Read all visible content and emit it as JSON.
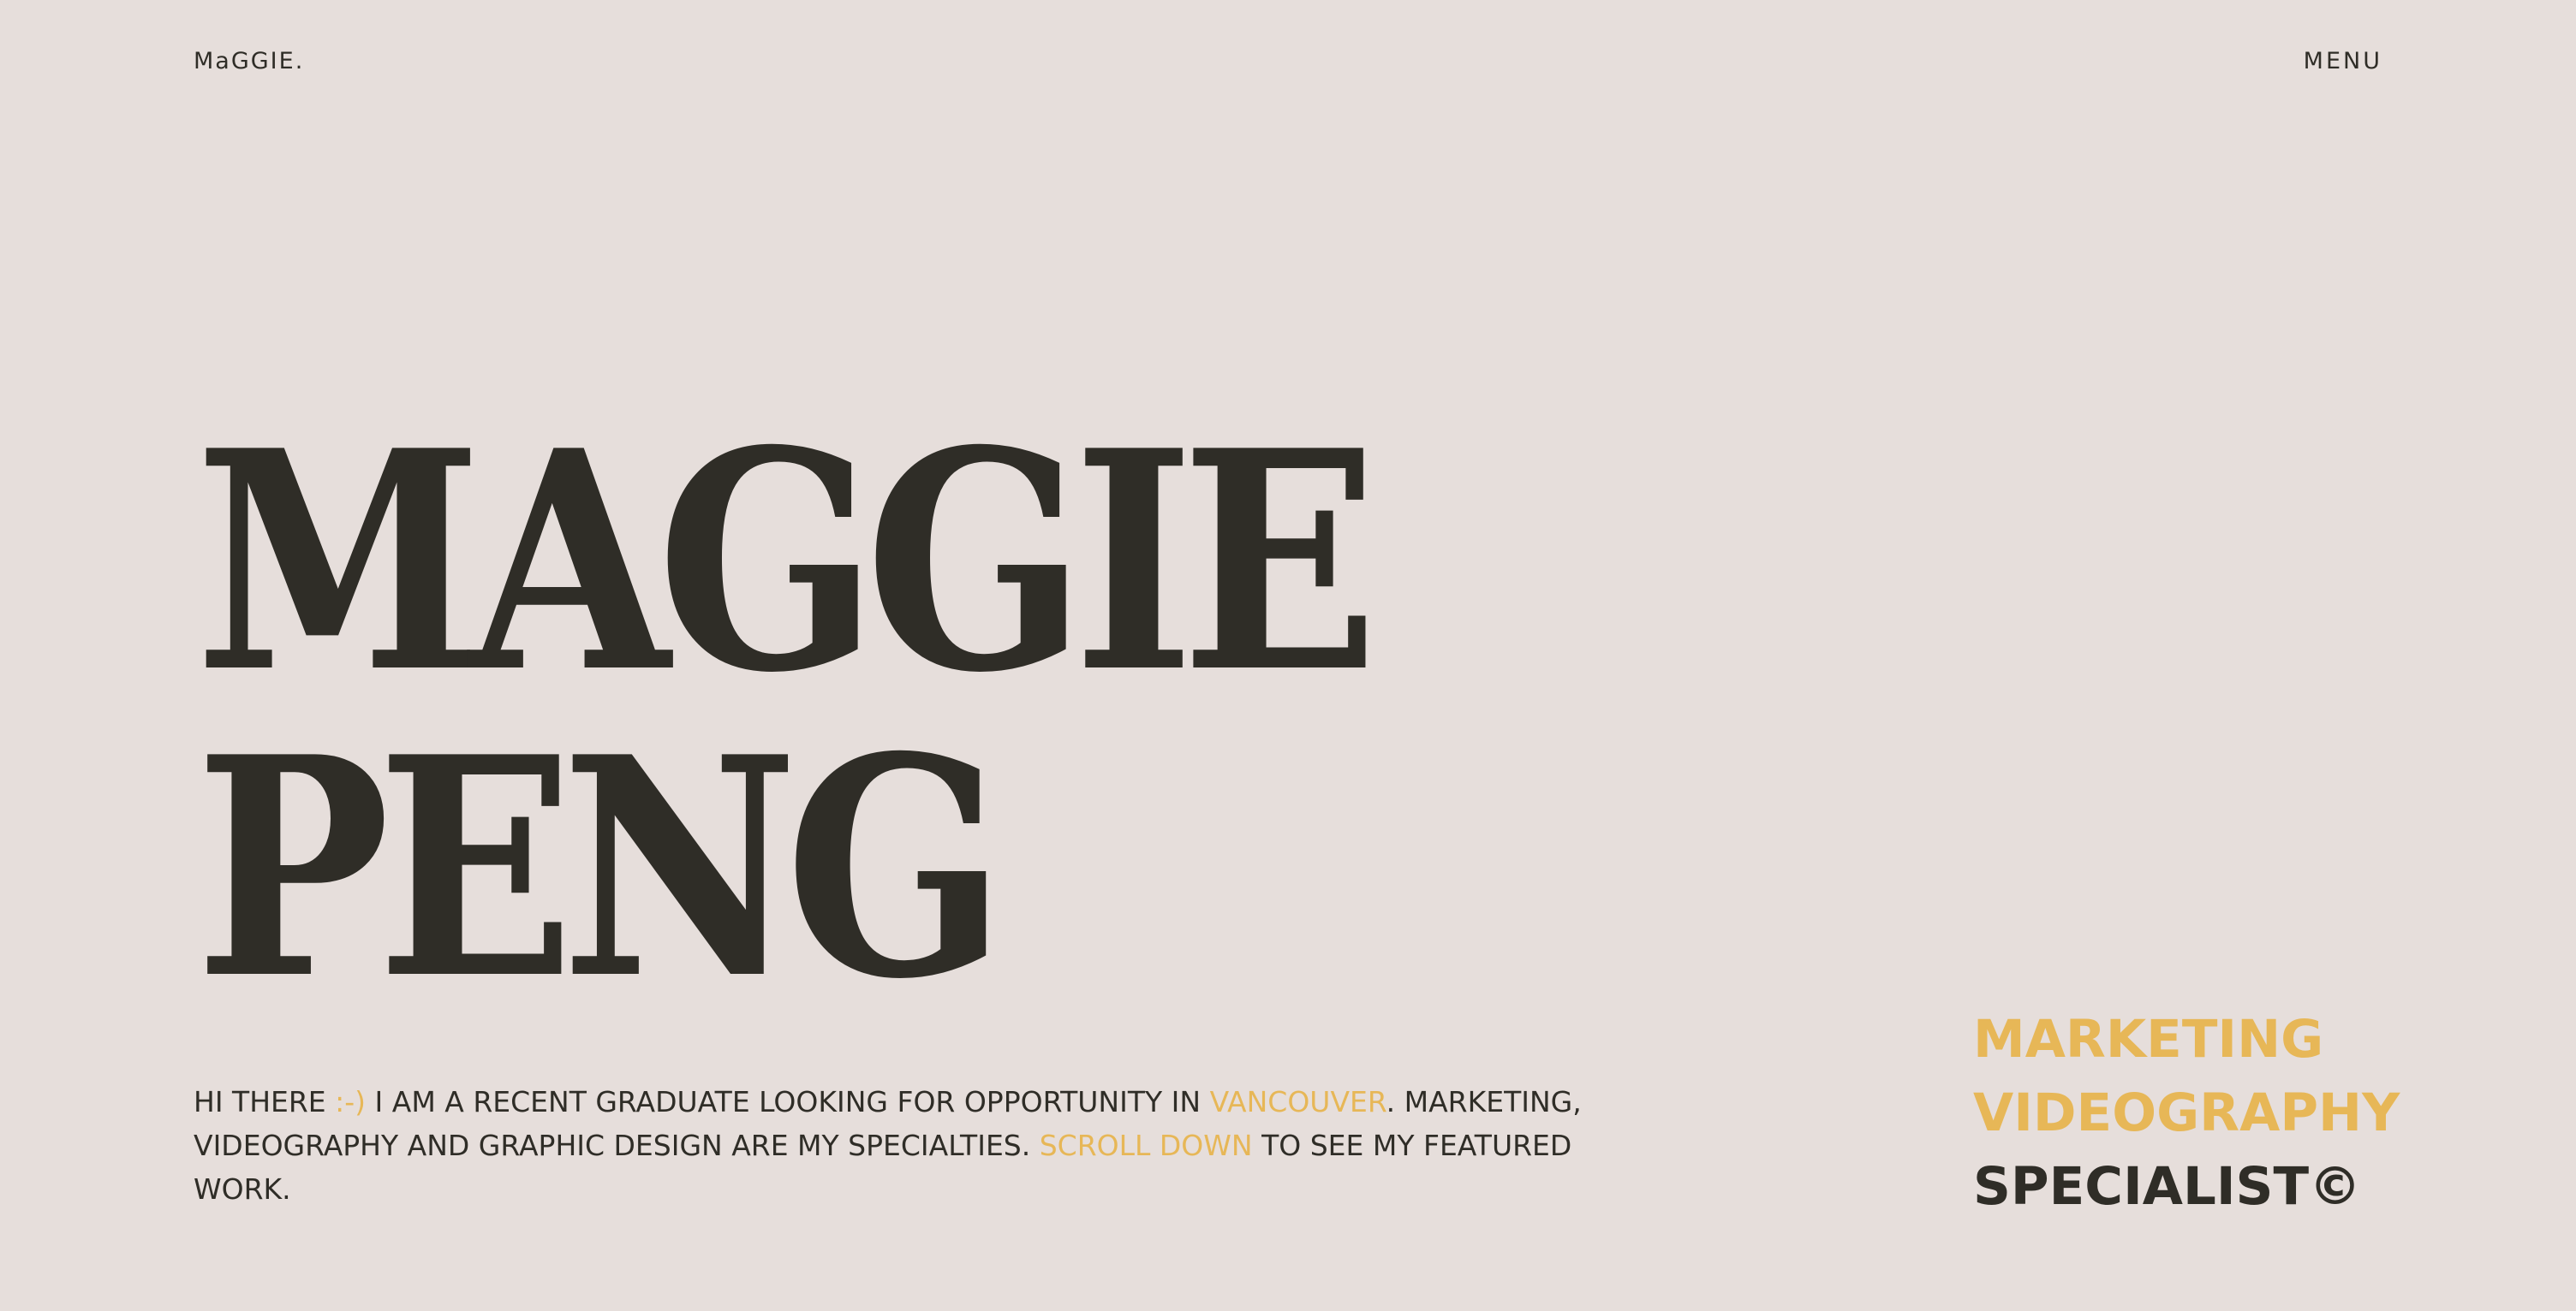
{
  "header": {
    "logo": "MaGGIE.",
    "menu_label": "MENU"
  },
  "hero": {
    "name_line1": "MAGGIE",
    "name_line2": "PENG"
  },
  "intro": {
    "part1": "HI THERE ",
    "smiley": ":-)",
    "part2": " I AM A RECENT GRADUATE LOOKING FOR OPPORTUNITY IN ",
    "city": "VANCOUVER",
    "part3": ". MARKETING, VIDEOGRAPHY AND GRAPHIC DESIGN ARE MY SPECIALTIES. ",
    "scroll_link": "SCROLL DOWN",
    "part4": " TO SEE MY FEATURED WORK."
  },
  "roles": {
    "line1": "MARKETING",
    "line2": "VIDEOGRAPHY",
    "line3": "SPECIALIST©"
  },
  "colors": {
    "background": "#e6dedb",
    "text": "#2f2d27",
    "accent": "#e7b757"
  }
}
